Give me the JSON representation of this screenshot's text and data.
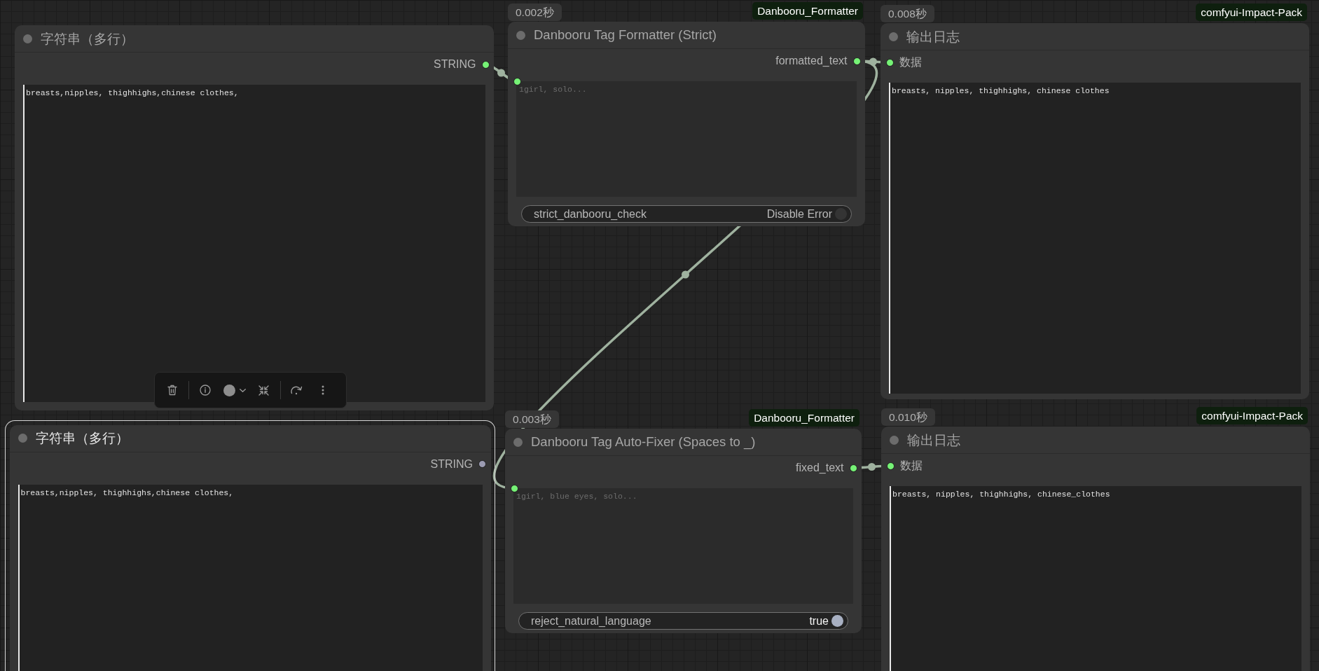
{
  "nodes": [
    {
      "kind": "string",
      "title": "字符串（多行）",
      "selected": false,
      "outputs": [
        {
          "label": "STRING",
          "connected": true
        }
      ],
      "text": {
        "value": "breasts,nipples, thighhighs,chinese clothes,"
      }
    },
    {
      "kind": "formatter",
      "title": "Danbooru Tag Formatter (Strict)",
      "selected": false,
      "time_badge": "0.002秒",
      "pack_badge": "Danbooru_Formatter",
      "outputs": [
        {
          "label": "formatted_text",
          "connected": true
        }
      ],
      "text": {
        "placeholder": "1girl, solo...",
        "input_connected": true
      },
      "toggle": {
        "label": "strict_danbooru_check",
        "value": "Disable Error",
        "on": false
      }
    },
    {
      "kind": "log",
      "title": "输出日志",
      "selected": false,
      "time_badge": "0.008秒",
      "pack_badge": "comfyui-Impact-Pack",
      "inputs": [
        {
          "label": "数据",
          "connected": true
        }
      ],
      "text": {
        "value": "breasts, nipples, thighhighs, chinese clothes"
      }
    },
    {
      "kind": "string",
      "title": "字符串（多行）",
      "selected": true,
      "outputs": [
        {
          "label": "STRING",
          "connected": false
        }
      ],
      "text": {
        "value": "breasts,nipples, thighhighs,chinese clothes,"
      }
    },
    {
      "kind": "formatter",
      "title": "Danbooru Tag Auto-Fixer (Spaces to _)",
      "selected": false,
      "time_badge": "0.003秒",
      "pack_badge": "Danbooru_Formatter",
      "outputs": [
        {
          "label": "fixed_text",
          "connected": true
        }
      ],
      "text": {
        "placeholder": "1girl, blue eyes, solo...",
        "input_connected": true
      },
      "toggle": {
        "label": "reject_natural_language",
        "value": "true",
        "on": true
      }
    },
    {
      "kind": "log",
      "title": "输出日志",
      "selected": false,
      "time_badge": "0.010秒",
      "pack_badge": "comfyui-Impact-Pack",
      "inputs": [
        {
          "label": "数据",
          "connected": true
        }
      ],
      "text": {
        "value": "breasts, nipples, thighhighs, chinese_clothes"
      }
    }
  ]
}
